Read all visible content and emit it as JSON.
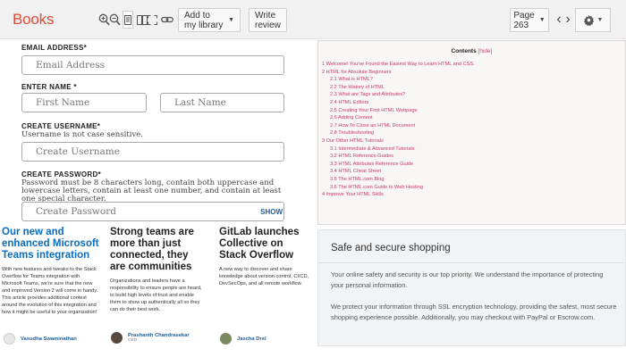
{
  "toolbar": {
    "brand": "Books",
    "add_library_label": "Add to my library",
    "write_review_label": "Write review",
    "page_label": "Page 263"
  },
  "form": {
    "email_label": "EMAIL ADDRESS*",
    "email_placeholder": "Email Address",
    "name_label": "ENTER NAME *",
    "first_name_placeholder": "First Name",
    "last_name_placeholder": "Last Name",
    "username_label": "CREATE USERNAME*",
    "username_help": "Username is not case sensitive.",
    "username_placeholder": "Create Username",
    "password_label": "CREATE PASSWORD*",
    "password_help": "Password must be 8 characters long, contain both uppercase and lowercase letters, contain at least one number, and contain at least one special character.",
    "password_placeholder": "Create Password",
    "show_label": "SHOW"
  },
  "contents": {
    "title": "Contents",
    "hide_label": "[hide]",
    "items": [
      {
        "text": "1 Welcome! You've Found the Easiest Way to Learn HTML and CSS.",
        "level": 0
      },
      {
        "text": "2 HTML for Absolute Beginners",
        "level": 0
      },
      {
        "text": "2.1 What is HTML?",
        "level": 1
      },
      {
        "text": "2.2 The History of HTML",
        "level": 1
      },
      {
        "text": "2.3 What are Tags and Attributes?",
        "level": 1
      },
      {
        "text": "2.4 HTML Editors",
        "level": 1
      },
      {
        "text": "2.5 Creating Your First HTML Webpage",
        "level": 1
      },
      {
        "text": "2.6 Adding Content",
        "level": 1
      },
      {
        "text": "2.7 How To Close an HTML Document",
        "level": 1
      },
      {
        "text": "2.8 Troubleshooting",
        "level": 1
      },
      {
        "text": "3 Our Other HTML Tutorials",
        "level": 0
      },
      {
        "text": "3.1 Intermediate & Advanced Tutorials",
        "level": 1
      },
      {
        "text": "3.2 HTML Reference Guides",
        "level": 1
      },
      {
        "text": "3.3 HTML Attributes Reference Guide",
        "level": 1
      },
      {
        "text": "3.4 HTML Cheat Sheet",
        "level": 1
      },
      {
        "text": "3.5 The HTML.com Blog",
        "level": 1
      },
      {
        "text": "3.6 The HTML.com Guide to Web Hosting",
        "level": 1
      },
      {
        "text": "4 Improve Your HTML Skills",
        "level": 0
      }
    ]
  },
  "articles": [
    {
      "title": "Our new and enhanced Microsoft Teams integration",
      "desc": "With new features and tweaks to the Stack Overflow for Teams integration with Microsoft Teams, we're sure that the new and improved Version 2 will come in handy. This article provides additional context around the evolution of this integration and how it might be useful to your organization!",
      "author": "Vasudha Swaminathan",
      "role": ""
    },
    {
      "title": "Strong teams are more than just connected, they are communities",
      "desc": "Organizations and leaders have a responsibility to ensure people are heard, to build high levels of trust and enable them to show up authentically all so they can do their best work.",
      "author": "Prashanth Chandrasekar",
      "role": "CEO"
    },
    {
      "title": "GitLab launches Collective on Stack Overflow",
      "desc": "A new way to discover and share knowledge about version control, CI/CD, DevSecOps, and all remote workflow.",
      "author": "Jascha Drel",
      "role": ""
    }
  ],
  "safe_shopping": {
    "title": "Safe and secure shopping",
    "p1": "Your online safety and security is our top priority. We understand the importance of protecting your personal information.",
    "p2": "We protect your information through SSL encryption technology, providing the safest, most secure shopping experience possible. Additionally, you may checkout with PayPal or Escrow.com."
  },
  "colors": {
    "brand": "#dd4b39",
    "link_pink": "#c8395f",
    "article_blue": "#0a6cbf"
  }
}
